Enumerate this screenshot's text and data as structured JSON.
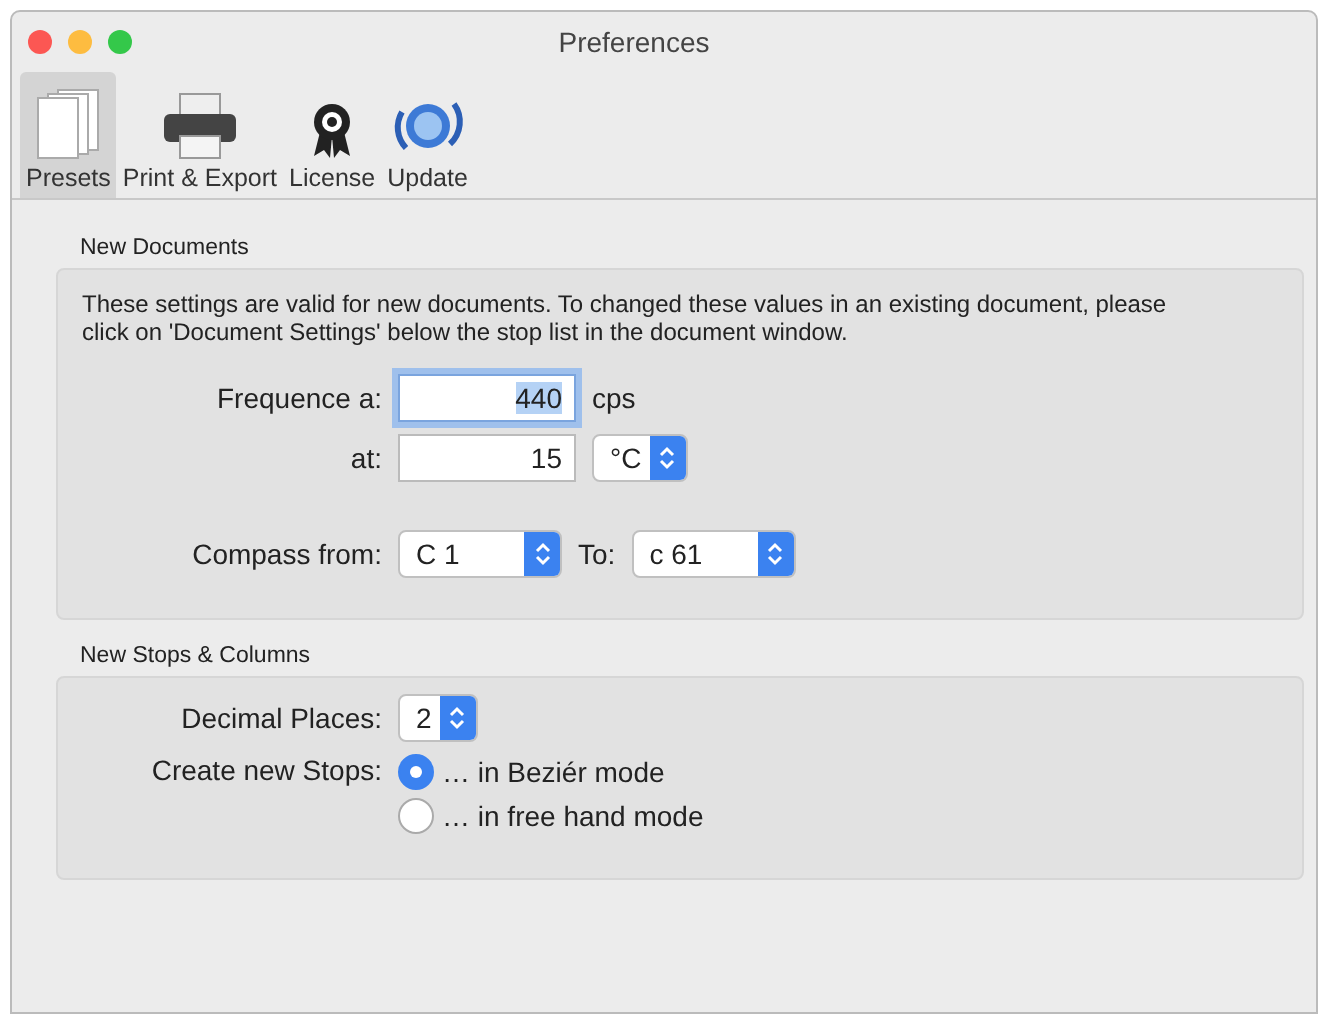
{
  "window": {
    "title": "Preferences"
  },
  "toolbar": [
    {
      "label": "Presets",
      "selected": true
    },
    {
      "label": "Print & Export",
      "selected": false
    },
    {
      "label": "License",
      "selected": false
    },
    {
      "label": "Update",
      "selected": false
    }
  ],
  "new_documents": {
    "title": "New Documents",
    "description": "These settings are valid for new documents. To changed these values in an existing document, please click on 'Document Settings' below the stop list in the document window.",
    "frequence": {
      "label": "Frequence a:",
      "value": "440",
      "focused": true,
      "unit": "cps"
    },
    "temperature": {
      "label": "at:",
      "value": "15",
      "unit": "°C"
    },
    "compass": {
      "label": "Compass from:",
      "from": "C 1",
      "to_label": "To:",
      "to": "c 61"
    }
  },
  "new_stops": {
    "title": "New Stops & Columns",
    "decimal": {
      "label": "Decimal Places:",
      "value": "2"
    },
    "create_label": "Create new Stops:",
    "modes": [
      {
        "label": "… in Beziér mode",
        "selected": true
      },
      {
        "label": "… in free hand mode",
        "selected": false
      }
    ]
  }
}
